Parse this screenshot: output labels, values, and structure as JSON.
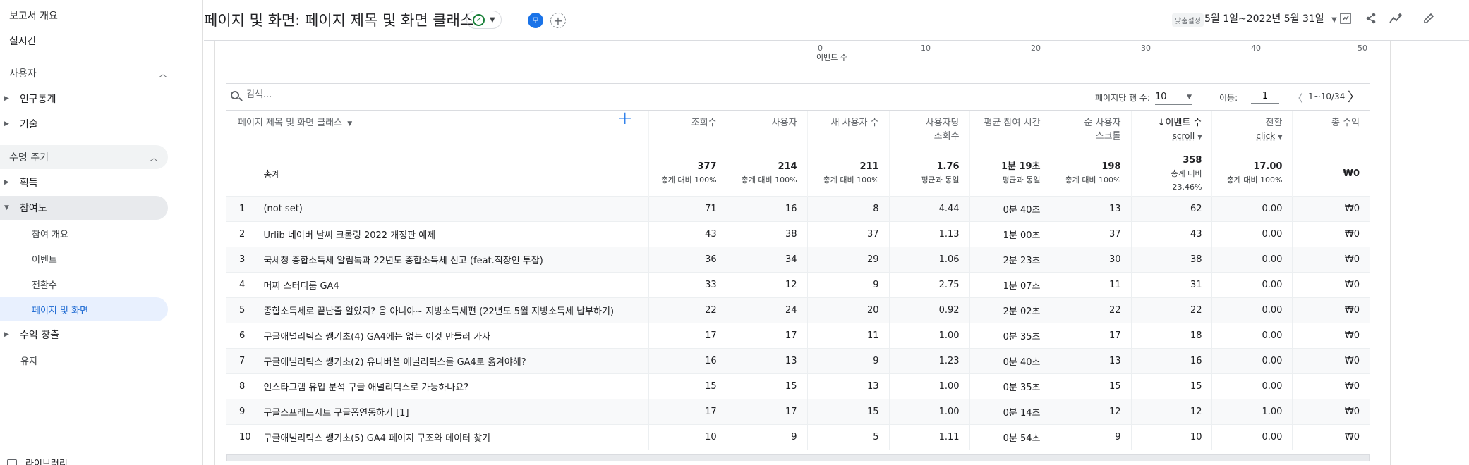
{
  "sidebar": {
    "report_overview": "보고서 개요",
    "realtime": "실시간",
    "users_section": "사용자",
    "demographics": "인구통계",
    "tech": "기술",
    "lifecycle_section": "수명 주기",
    "acquisition": "획득",
    "engagement": "참여도",
    "engagement_overview": "참여 개요",
    "events": "이벤트",
    "conversions": "전환수",
    "pages_screens": "페이지 및 화면",
    "monetization": "수익 창출",
    "retention": "유지",
    "library": "라이브러리"
  },
  "header": {
    "title": "페이지 및 화면: 페이지 제목 및 화면 클래스",
    "avatar": "모",
    "custom": "맞춤설정",
    "date_range": "5월 1일~2022년 5월 31일"
  },
  "chart_axis": {
    "ticks": [
      "0",
      "10",
      "20",
      "30",
      "40",
      "50"
    ],
    "title": "이벤트 수"
  },
  "toolbar": {
    "search_placeholder": "검색...",
    "rows_per_page_label": "페이지당 행 수:",
    "rows_per_page": "10",
    "goto_label": "이동:",
    "goto_value": "1",
    "pagination": "1~10/34"
  },
  "table": {
    "dimension_header": "페이지 제목 및 화면 클래스",
    "columns": [
      {
        "label": "조회수",
        "sub": ""
      },
      {
        "label": "사용자",
        "sub": ""
      },
      {
        "label": "새 사용자 수",
        "sub": ""
      },
      {
        "label": "사용자당 조회수",
        "sub": ""
      },
      {
        "label": "평균 참여 시간",
        "sub": ""
      },
      {
        "label": "순 사용자 스크롤",
        "sub": ""
      },
      {
        "label": "↓이벤트 수",
        "sub": "scroll"
      },
      {
        "label": "전환",
        "sub": "click"
      },
      {
        "label": "총 수익",
        "sub": ""
      }
    ],
    "total_label": "총계",
    "totals": [
      {
        "value": "377",
        "sub": "총계 대비 100%"
      },
      {
        "value": "214",
        "sub": "총계 대비 100%"
      },
      {
        "value": "211",
        "sub": "총계 대비 100%"
      },
      {
        "value": "1.76",
        "sub": "평균과 동일"
      },
      {
        "value": "1분 19초",
        "sub": "평균과 동일"
      },
      {
        "value": "198",
        "sub": "총계 대비 100%"
      },
      {
        "value": "358",
        "sub": "총계 대비 23.46%"
      },
      {
        "value": "17.00",
        "sub": "총계 대비 100%"
      },
      {
        "value": "₩0",
        "sub": ""
      }
    ],
    "rows": [
      {
        "idx": "1",
        "name": "(not set)",
        "values": [
          "71",
          "16",
          "8",
          "4.44",
          "0분 40초",
          "13",
          "62",
          "0.00",
          "₩0"
        ]
      },
      {
        "idx": "2",
        "name": "Urlib 네이버 날씨 크롤링 2022 개정판 예제",
        "values": [
          "43",
          "38",
          "37",
          "1.13",
          "1분 00초",
          "37",
          "43",
          "0.00",
          "₩0"
        ]
      },
      {
        "idx": "3",
        "name": "국세청 종합소득세 알림톡과 22년도 종합소득세 신고 (feat.직장인 투잡)",
        "values": [
          "36",
          "34",
          "29",
          "1.06",
          "2분 23초",
          "30",
          "38",
          "0.00",
          "₩0"
        ]
      },
      {
        "idx": "4",
        "name": "머찌 스터디룸 GA4",
        "values": [
          "33",
          "12",
          "9",
          "2.75",
          "1분 07초",
          "11",
          "31",
          "0.00",
          "₩0"
        ]
      },
      {
        "idx": "5",
        "name": "종합소득세로 끝난줄 알았지? 응 아니야~ 지방소득세편 (22년도 5월 지방소득세 납부하기)",
        "values": [
          "22",
          "24",
          "20",
          "0.92",
          "2분 02초",
          "22",
          "22",
          "0.00",
          "₩0"
        ]
      },
      {
        "idx": "6",
        "name": "구글애널리틱스 쌩기초(4) GA4에는 없는 이것 만들러 가자",
        "values": [
          "17",
          "17",
          "11",
          "1.00",
          "0분 35초",
          "17",
          "18",
          "0.00",
          "₩0"
        ]
      },
      {
        "idx": "7",
        "name": "구글애널리틱스 쌩기초(2) 유니버셜 애널리틱스를 GA4로 옮겨야해?",
        "values": [
          "16",
          "13",
          "9",
          "1.23",
          "0분 40초",
          "13",
          "16",
          "0.00",
          "₩0"
        ]
      },
      {
        "idx": "8",
        "name": "인스타그램 유입 분석 구글 애널리틱스로 가능하나요?",
        "values": [
          "15",
          "15",
          "13",
          "1.00",
          "0분 35초",
          "15",
          "15",
          "0.00",
          "₩0"
        ]
      },
      {
        "idx": "9",
        "name": "구글스프레드시트 구글폼연동하기 [1]",
        "values": [
          "17",
          "17",
          "15",
          "1.00",
          "0분 14초",
          "12",
          "12",
          "1.00",
          "₩0"
        ]
      },
      {
        "idx": "10",
        "name": "구글애널리틱스 쌩기초(5) GA4 페이지 구조와 데이터 찾기",
        "values": [
          "10",
          "9",
          "5",
          "1.11",
          "0분 54초",
          "9",
          "10",
          "0.00",
          "₩0"
        ]
      }
    ]
  }
}
